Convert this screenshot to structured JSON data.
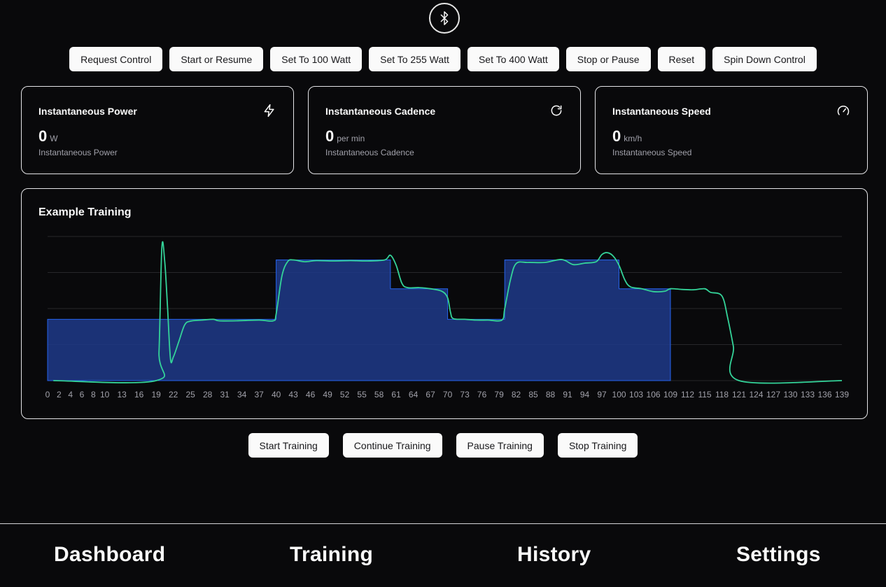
{
  "header": {
    "bluetooth_icon": "bluetooth-icon"
  },
  "controls": [
    {
      "label": "Request Control"
    },
    {
      "label": "Start or Resume"
    },
    {
      "label": "Set To 100 Watt"
    },
    {
      "label": "Set To 255 Watt"
    },
    {
      "label": "Set To 400 Watt"
    },
    {
      "label": "Stop or Pause"
    },
    {
      "label": "Reset"
    },
    {
      "label": "Spin Down Control"
    }
  ],
  "metrics": {
    "power": {
      "title": "Instantaneous Power",
      "value": "0",
      "unit": "W",
      "subtitle": "Instantaneous Power",
      "icon": "lightning-bolt-icon"
    },
    "cadence": {
      "title": "Instantaneous Cadence",
      "value": "0",
      "unit": "per min",
      "subtitle": "Instantaneous Cadence",
      "icon": "refresh-icon"
    },
    "speed": {
      "title": "Instantaneous Speed",
      "value": "0",
      "unit": "km/h",
      "subtitle": "Instantaneous Speed",
      "icon": "speedometer-icon"
    }
  },
  "chart": {
    "title": "Example Training"
  },
  "chart_data": {
    "type": "area",
    "title": "Example Training",
    "xlabel": "",
    "ylabel": "",
    "tick_labels": [
      "0",
      "2",
      "4",
      "6",
      "8",
      "10",
      "13",
      "16",
      "19",
      "22",
      "25",
      "28",
      "31",
      "34",
      "37",
      "40",
      "43",
      "46",
      "49",
      "52",
      "55",
      "58",
      "61",
      "64",
      "67",
      "70",
      "73",
      "76",
      "79",
      "82",
      "85",
      "88",
      "91",
      "94",
      "97",
      "100",
      "103",
      "106",
      "109",
      "112",
      "115",
      "118",
      "121",
      "124",
      "127",
      "130",
      "133",
      "136",
      "139"
    ],
    "xlim": [
      0,
      139
    ],
    "ylim": [
      0,
      400
    ],
    "grid": true,
    "colors": {
      "target_fill": "#1e3a8a",
      "target_stroke": "#2563eb",
      "actual_line": "#34d399",
      "grid": "#27272a",
      "tick": "#a1a1aa"
    },
    "series": [
      {
        "style": "step-area",
        "points": [
          [
            0,
            170
          ],
          [
            20,
            170
          ],
          [
            40,
            170
          ],
          [
            40,
            335
          ],
          [
            60,
            335
          ],
          [
            60,
            255
          ],
          [
            70,
            255
          ],
          [
            70,
            170
          ],
          [
            80,
            170
          ],
          [
            80,
            335
          ],
          [
            100,
            335
          ],
          [
            100,
            255
          ],
          [
            109,
            255
          ],
          [
            109,
            0
          ]
        ]
      },
      {
        "style": "line",
        "points": [
          [
            1,
            0
          ],
          [
            19,
            0
          ],
          [
            19.5,
            80
          ],
          [
            20,
            370
          ],
          [
            20.5,
            330
          ],
          [
            21,
            200
          ],
          [
            21.5,
            60
          ],
          [
            22,
            65
          ],
          [
            23,
            110
          ],
          [
            24,
            155
          ],
          [
            25,
            165
          ],
          [
            27,
            168
          ],
          [
            29,
            170
          ],
          [
            30,
            166
          ],
          [
            33,
            166
          ],
          [
            37,
            168
          ],
          [
            39.5,
            166
          ],
          [
            40,
            185
          ],
          [
            41,
            290
          ],
          [
            42,
            330
          ],
          [
            43,
            335
          ],
          [
            45,
            330
          ],
          [
            47,
            333
          ],
          [
            50,
            332
          ],
          [
            53,
            333
          ],
          [
            56,
            332
          ],
          [
            59,
            335
          ],
          [
            60,
            348
          ],
          [
            61,
            320
          ],
          [
            62,
            270
          ],
          [
            63,
            258
          ],
          [
            65,
            258
          ],
          [
            67,
            255
          ],
          [
            69,
            248
          ],
          [
            70,
            230
          ],
          [
            70.5,
            190
          ],
          [
            71,
            172
          ],
          [
            73,
            170
          ],
          [
            75,
            168
          ],
          [
            77,
            168
          ],
          [
            79.5,
            168
          ],
          [
            80,
            200
          ],
          [
            81,
            280
          ],
          [
            82,
            325
          ],
          [
            84,
            328
          ],
          [
            87,
            328
          ],
          [
            90,
            336
          ],
          [
            92,
            322
          ],
          [
            94,
            326
          ],
          [
            96,
            330
          ],
          [
            97,
            350
          ],
          [
            98,
            355
          ],
          [
            99,
            345
          ],
          [
            100,
            320
          ],
          [
            101,
            280
          ],
          [
            102,
            260
          ],
          [
            104,
            255
          ],
          [
            106,
            247
          ],
          [
            108,
            248
          ],
          [
            109,
            255
          ],
          [
            111,
            253
          ],
          [
            113,
            252
          ],
          [
            115,
            255
          ],
          [
            116,
            245
          ],
          [
            118,
            235
          ],
          [
            119,
            175
          ],
          [
            120,
            95
          ],
          [
            121,
            0
          ],
          [
            139,
            0
          ]
        ]
      }
    ]
  },
  "training_controls": [
    {
      "label": "Start Training"
    },
    {
      "label": "Continue Training"
    },
    {
      "label": "Pause Training"
    },
    {
      "label": "Stop Training"
    }
  ],
  "nav": [
    {
      "label": "Dashboard"
    },
    {
      "label": "Training"
    },
    {
      "label": "History"
    },
    {
      "label": "Settings"
    }
  ]
}
